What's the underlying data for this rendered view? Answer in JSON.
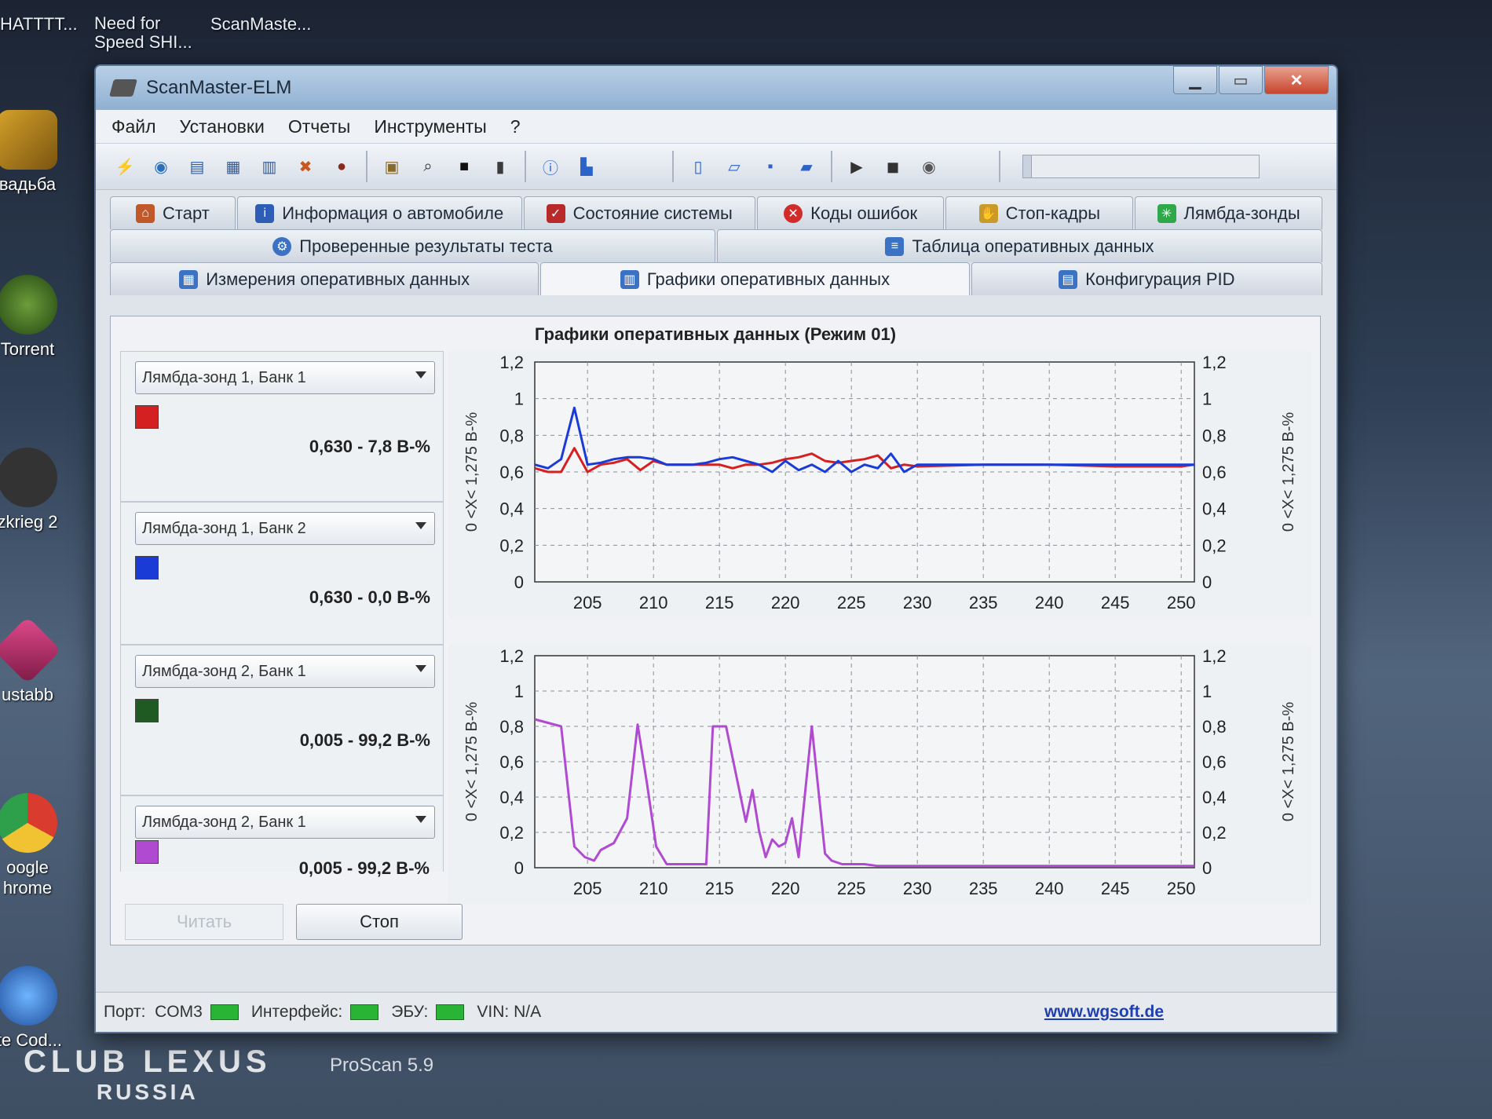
{
  "desktop": {
    "top_labels": [
      "HATTTT...",
      "Need for Speed SHI...",
      "ScanMaste..."
    ],
    "icons": [
      "вадьба",
      "Torrent",
      "zkrieg 2",
      "ustabb",
      "oogle hrome",
      "ite Cod..."
    ],
    "watermark_main": "CLUB LEXUS",
    "watermark_sub": "RUSSIA",
    "taskbar_label": "ProScan 5.9"
  },
  "window": {
    "title": "ScanMaster-ELM",
    "menu": [
      "Файл",
      "Установки",
      "Отчеты",
      "Инструменты",
      "?"
    ]
  },
  "tabs": {
    "row1": [
      "Старт",
      "Информация о автомобиле",
      "Состояние системы",
      "Коды ошибок",
      "Стоп-кадры",
      "Лямбда-зонды"
    ],
    "row2": [
      "Проверенные результаты теста",
      "Таблица оперативных данных"
    ],
    "row3": [
      "Измерения оперативных данных",
      "Графики оперативных данных",
      "Конфигурация PID"
    ],
    "active": "Графики оперативных данных"
  },
  "panel": {
    "title": "Графики оперативных данных (Режим 01)",
    "sensors": [
      {
        "select": "Лямбда-зонд 1, Банк 1",
        "color": "#d42020",
        "reading": "0,630 - 7,8 В-%"
      },
      {
        "select": "Лямбда-зонд 1, Банк 2",
        "color": "#1a3bd6",
        "reading": "0,630 - 0,0 В-%"
      },
      {
        "select": "Лямбда-зонд 2, Банк 1",
        "color": "#1e5a22",
        "reading": "0,005 - 99,2 В-%"
      },
      {
        "select": "Лямбда-зонд 2, Банк 1",
        "color": "#b04ad0",
        "reading": "0,005 - 99,2 В-%"
      }
    ],
    "buttons": {
      "read": "Читать",
      "stop": "Стоп"
    }
  },
  "statusbar": {
    "port_label": "Порт:",
    "port_value": "COM3",
    "interface_label": "Интерфейс:",
    "ecu_label": "ЭБУ:",
    "vin": "VIN: N/A",
    "link": "www.wgsoft.de"
  },
  "chart_data": [
    {
      "type": "line",
      "axis_label": "0 <X< 1,275 В-%",
      "xlim": [
        201,
        251
      ],
      "ylim": [
        0,
        1.2
      ],
      "xticks": [
        205,
        210,
        215,
        220,
        225,
        230,
        235,
        240,
        245,
        250
      ],
      "yticks": [
        "0",
        "0,2",
        "0,4",
        "0,6",
        "0,8",
        "1",
        "1,2"
      ],
      "grid": true,
      "series": [
        {
          "color": "#d42020",
          "x": [
            201,
            202,
            203,
            204,
            205,
            206,
            207,
            208,
            209,
            210,
            211,
            212,
            213,
            214,
            215,
            216,
            217,
            218,
            219,
            220,
            221,
            222,
            223,
            224,
            225,
            226,
            227,
            228,
            229,
            230,
            235,
            240,
            245,
            250,
            251
          ],
          "y": [
            0.62,
            0.6,
            0.6,
            0.73,
            0.6,
            0.64,
            0.65,
            0.67,
            0.61,
            0.66,
            0.64,
            0.64,
            0.64,
            0.64,
            0.64,
            0.62,
            0.64,
            0.64,
            0.65,
            0.67,
            0.68,
            0.7,
            0.66,
            0.65,
            0.66,
            0.67,
            0.69,
            0.62,
            0.64,
            0.63,
            0.64,
            0.64,
            0.63,
            0.63,
            0.64
          ]
        },
        {
          "color": "#1a3bd6",
          "x": [
            201,
            202,
            203,
            204,
            205,
            206,
            207,
            208,
            209,
            210,
            211,
            212,
            213,
            214,
            215,
            216,
            217,
            218,
            219,
            220,
            221,
            222,
            223,
            224,
            225,
            226,
            227,
            228,
            229,
            230,
            235,
            240,
            245,
            250,
            251
          ],
          "y": [
            0.64,
            0.62,
            0.67,
            0.95,
            0.64,
            0.65,
            0.67,
            0.68,
            0.68,
            0.67,
            0.64,
            0.64,
            0.64,
            0.65,
            0.67,
            0.68,
            0.66,
            0.64,
            0.6,
            0.66,
            0.61,
            0.64,
            0.6,
            0.66,
            0.6,
            0.64,
            0.62,
            0.7,
            0.6,
            0.64,
            0.64,
            0.64,
            0.64,
            0.64,
            0.64
          ]
        }
      ]
    },
    {
      "type": "line",
      "axis_label": "0 <X< 1,275 В-%",
      "xlim": [
        201,
        251
      ],
      "ylim": [
        0,
        1.2
      ],
      "xticks": [
        205,
        210,
        215,
        220,
        225,
        230,
        235,
        240,
        245,
        250
      ],
      "yticks": [
        "0",
        "0,2",
        "0,4",
        "0,6",
        "0,8",
        "1",
        "1,2"
      ],
      "grid": true,
      "series": [
        {
          "color": "#b04ad0",
          "x": [
            201,
            202,
            203,
            204,
            204.8,
            205.5,
            206,
            207,
            208,
            208.8,
            209.5,
            210.2,
            211,
            212,
            213,
            214,
            214.5,
            215.5,
            216,
            217,
            217.5,
            218,
            218.5,
            219,
            219.5,
            220,
            220.5,
            221,
            222,
            223,
            223.5,
            224.3,
            225,
            226,
            227,
            228,
            230,
            235,
            240,
            245,
            250,
            251
          ],
          "y": [
            0.84,
            0.82,
            0.8,
            0.12,
            0.06,
            0.04,
            0.1,
            0.14,
            0.28,
            0.81,
            0.48,
            0.12,
            0.02,
            0.02,
            0.02,
            0.02,
            0.8,
            0.8,
            0.62,
            0.26,
            0.44,
            0.21,
            0.06,
            0.16,
            0.12,
            0.14,
            0.28,
            0.06,
            0.8,
            0.08,
            0.04,
            0.02,
            0.02,
            0.02,
            0.01,
            0.01,
            0.01,
            0.01,
            0.01,
            0.01,
            0.01,
            0.01
          ]
        }
      ]
    }
  ]
}
